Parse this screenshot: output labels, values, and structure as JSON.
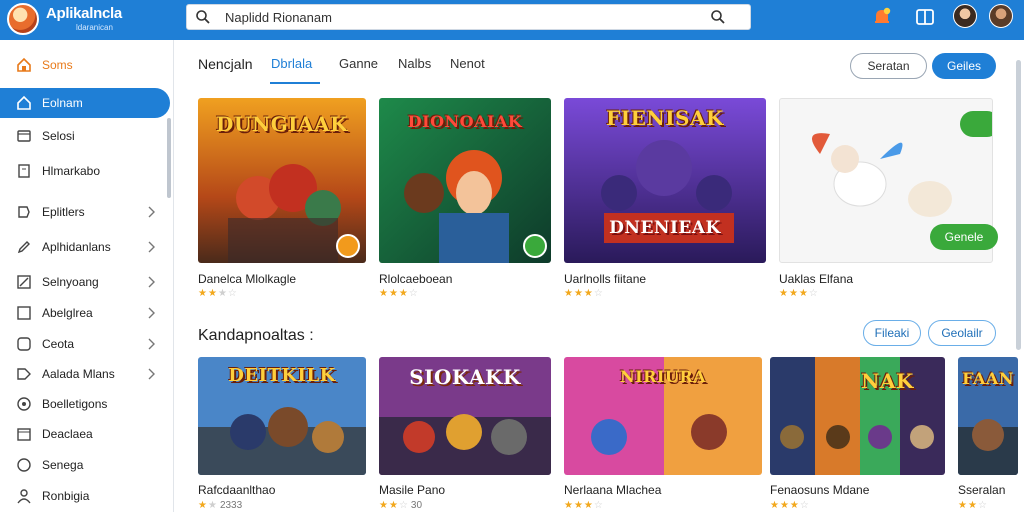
{
  "app": {
    "title": "Aplikalncla",
    "subtitle": "ldaranican"
  },
  "search": {
    "value": "Naplidd Rionanam"
  },
  "sidebar": {
    "items": [
      {
        "label": "Soms",
        "icon": "home-icon"
      },
      {
        "label": "Eolnam",
        "icon": "home-outline-icon"
      },
      {
        "label": "Selosi",
        "icon": "window-icon"
      },
      {
        "label": "Hlmarkabo",
        "icon": "document-icon"
      },
      {
        "label": "Eplitlers",
        "icon": "bookmark-icon"
      },
      {
        "label": "Aplhidanlans",
        "icon": "pencil-icon"
      },
      {
        "label": "Selnyoang",
        "icon": "edit-icon"
      },
      {
        "label": "Abelglrea",
        "icon": "square-icon"
      },
      {
        "label": "Ceota",
        "icon": "rounded-square-icon"
      },
      {
        "label": "Aalada Mlans",
        "icon": "tag-icon"
      },
      {
        "label": "Boelletigons",
        "icon": "circle-icon"
      },
      {
        "label": "Deaclaea",
        "icon": "calendar-icon"
      },
      {
        "label": "Senega",
        "icon": "circle-check-icon"
      },
      {
        "label": "Ronbigia",
        "icon": "person-icon"
      }
    ]
  },
  "tabs": [
    {
      "label": "Nencjaln"
    },
    {
      "label": "Dbrlala"
    },
    {
      "label": "Ganne"
    },
    {
      "label": "Nalbs"
    },
    {
      "label": "Nenot"
    }
  ],
  "header_buttons": {
    "outline": "Seratan",
    "primary": "Geiles"
  },
  "featured": [
    {
      "name": "Danelca Mlolkagle",
      "art_title": "DUNGIAAK",
      "stars": 2.5,
      "count": ""
    },
    {
      "name": "Rlolcaeboean",
      "art_title": "DIONOAIAK",
      "stars": 3,
      "count": ""
    },
    {
      "name": "Uarlnolls fiitane",
      "art_title": "FIENISAK",
      "art_title2": "DNENIEAK",
      "stars": 2.5,
      "count": ""
    },
    {
      "name": "Uaklas Elfana",
      "art_title": "",
      "stars": 3,
      "count": "",
      "button": "Genele"
    }
  ],
  "section": {
    "title": "Kandapnoaltas :",
    "btn1": "Fileaki",
    "btn2": "Geolailr"
  },
  "recommended": [
    {
      "name": "Rafcdaanlthao",
      "art_title": "DEITKILK",
      "stars": 1,
      "count": "2333"
    },
    {
      "name": "Masile Pano",
      "art_title": "SIOKAKK",
      "stars": 2,
      "count": "30"
    },
    {
      "name": "Nerlaana Mlachea",
      "art_title": "NIRIURA",
      "stars": 3,
      "count": ""
    },
    {
      "name": "Fenaosuns Mdane",
      "art_title": "NAK",
      "stars": 3,
      "count": ""
    },
    {
      "name": "Sseralan",
      "art_title": "FAAN",
      "stars": 2,
      "count": ""
    }
  ],
  "colors": {
    "primary": "#1f7fd6",
    "accent": "#e87a1a",
    "star": "#f2a81d",
    "green": "#3aa93b"
  }
}
